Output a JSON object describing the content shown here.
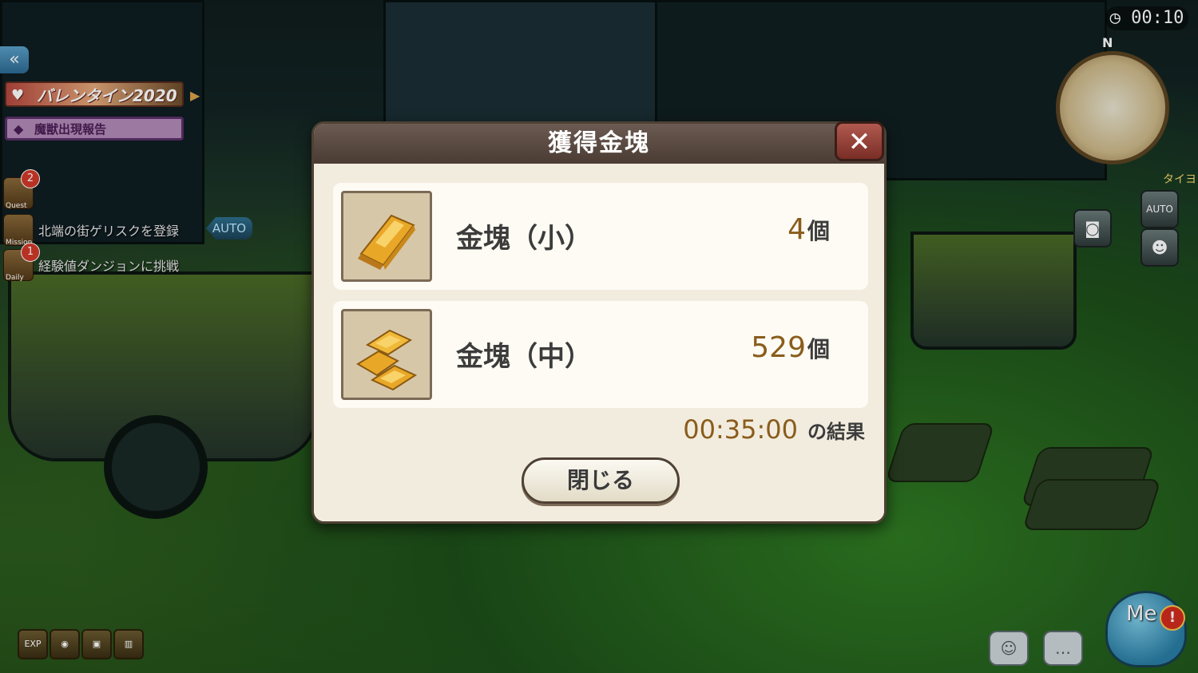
{
  "hud": {
    "back_icon": "double-chevron-left-icon",
    "event_banner": "バレンタイン2020",
    "monster_report": "魔獣出現報告",
    "quests": [
      {
        "tag": "Quest",
        "badge": "2",
        "text": ""
      },
      {
        "tag": "Mission",
        "badge": "",
        "text": "北端の街ゲリスクを登録"
      },
      {
        "tag": "Daily",
        "badge": "1",
        "text": "経験値ダンジョンに挑戦"
      }
    ],
    "auto_label": "AUTO",
    "tool_exp": "EXP",
    "clock": "00:10",
    "compass": "N",
    "player_name": "タイヨ",
    "side_auto": "AUTO",
    "menu_label": "Me",
    "alert": "!"
  },
  "dialog": {
    "title": "獲得金塊",
    "close_icon": "close-x-icon",
    "items": [
      {
        "name": "金塊（小）",
        "count": "4",
        "unit": "個",
        "icon": "gold-bar-icon"
      },
      {
        "name": "金塊（中）",
        "count": "529",
        "unit": "個",
        "icon": "gold-bar-stack-icon"
      }
    ],
    "result_time": "00:35:00",
    "result_suffix": "の結果",
    "close_button": "閉じる"
  },
  "colors": {
    "accent_gold": "#8a5c1c",
    "header": "#5a4a41",
    "close_red": "#9a463c"
  }
}
